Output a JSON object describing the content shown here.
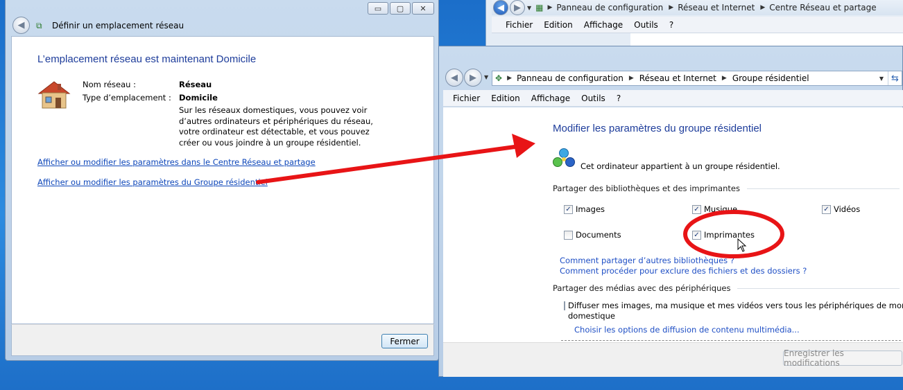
{
  "back_window": {
    "breadcrumb": [
      "Panneau de configuration",
      "Réseau et Internet",
      "Centre Réseau et partage"
    ],
    "menu": [
      "Fichier",
      "Edition",
      "Affichage",
      "Outils",
      "?"
    ]
  },
  "left_window": {
    "caption_title": "Définir un emplacement réseau",
    "caption_buttons": {
      "minimize": "▭",
      "maximize": "▢",
      "close": "✕"
    },
    "heading": "L’emplacement réseau est maintenant Domicile",
    "network_name_label": "Nom réseau :",
    "network_name_value": "Réseau",
    "location_type_label": "Type d’emplacement :",
    "location_type_value": "Domicile",
    "description": "Sur les réseaux domestiques, vous pouvez voir d’autres ordinateurs et périphériques du réseau, votre ordinateur est détectable, et vous pouvez créer ou vous joindre à un groupe résidentiel.",
    "link_network_center": "Afficher ou modifier les paramètres dans le Centre Réseau et partage",
    "link_homegroup": "Afficher ou modifier les paramètres du Groupe résidentiel",
    "close_button": "Fermer"
  },
  "right_window": {
    "breadcrumb": [
      "Panneau de configuration",
      "Réseau et Internet",
      "Groupe résidentiel"
    ],
    "menu": [
      "Fichier",
      "Edition",
      "Affichage",
      "Outils",
      "?"
    ],
    "heading": "Modifier les paramètres du groupe résidentiel",
    "membership": "Cet ordinateur appartient à un groupe résidentiel.",
    "section_libraries": "Partager des bibliothèques et des imprimantes",
    "libraries": [
      {
        "label": "Images",
        "checked": true
      },
      {
        "label": "Musique",
        "checked": true
      },
      {
        "label": "Vidéos",
        "checked": true
      },
      {
        "label": "Documents",
        "checked": false
      },
      {
        "label": "Imprimantes",
        "checked": true
      }
    ],
    "link_share_other": "Comment partager d’autres bibliothèques ?",
    "link_exclude": "Comment procéder pour exclure des fichiers et des dossiers ?",
    "section_media": "Partager des médias avec des périphériques",
    "media_checkbox_label_1": "Diffuser mes images, ma musique et mes vidéos vers tous les périphériques de mon réseau",
    "media_checkbox_label_2": "domestique",
    "media_checked": false,
    "link_streaming": "Choisir les options de diffusion de contenu multimédia...",
    "save_button": "Enregistrer les modifications"
  },
  "colors": {
    "arrow": "#e81416",
    "link": "#0d46b9",
    "heading": "#1e3d9b"
  },
  "icons": [
    "back-icon",
    "forward-icon",
    "network-icon",
    "house-icon",
    "homegroup-icon",
    "refresh-icon",
    "dropdown-icon",
    "cursor-icon"
  ]
}
